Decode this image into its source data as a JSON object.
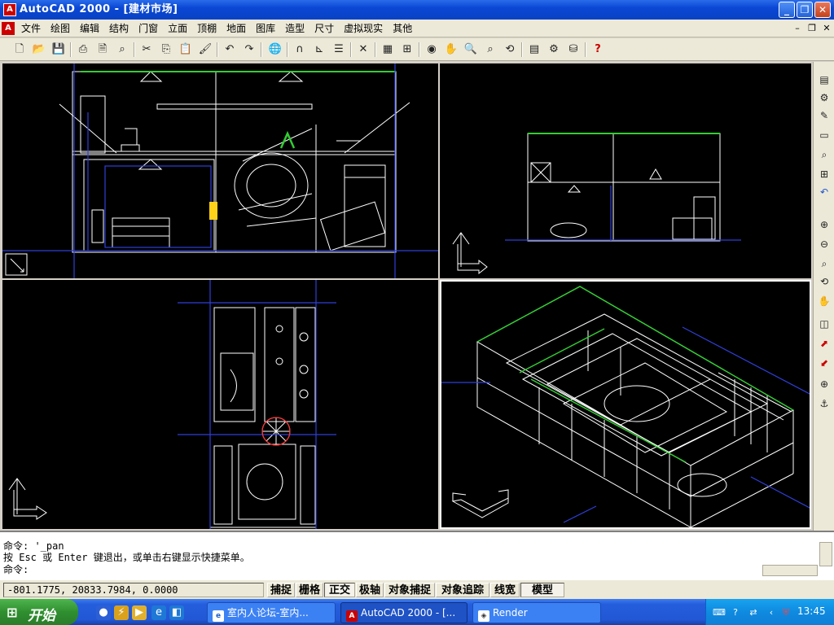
{
  "window": {
    "title": "AutoCAD 2000 - [建材市场]",
    "app_icon": "autocad-icon"
  },
  "menubar": {
    "items": [
      "文件",
      "绘图",
      "编辑",
      "结构",
      "门窗",
      "立面",
      "顶棚",
      "地面",
      "图库",
      "造型",
      "尺寸",
      "虚拟现实",
      "其他"
    ]
  },
  "toolbar": {
    "icons": [
      "new-icon",
      "open-icon",
      "save-icon",
      "print-icon",
      "print-preview-icon",
      "find-icon",
      "cut-icon",
      "copy-icon",
      "paste-icon",
      "match-properties-icon",
      "undo-icon",
      "redo-icon",
      "hyperlink-icon",
      "snap-icon",
      "ucs-icon",
      "list-icon",
      "measure-icon",
      "named-views-icon",
      "tiled-viewports-icon",
      "3d-orbit-icon",
      "pan-icon",
      "zoom-realtime-icon",
      "zoom-window-icon",
      "zoom-previous-icon",
      "properties-icon",
      "design-center-icon",
      "database-icon",
      "help-icon"
    ]
  },
  "colors": {
    "model_space": "#000000",
    "line_white": "#ffffff",
    "line_green": "#33cc33",
    "line_blue": "#2f3fd8",
    "line_yellow": "#ffd21a",
    "titlebar": "#0a47d4",
    "taskbar": "#245edc"
  },
  "command": {
    "lines": [
      "命令: '_pan",
      "按 Esc 或 Enter 键退出，或单击右键显示快捷菜单。",
      "命令:"
    ]
  },
  "status": {
    "coordinates": "-801.1775, 20833.7984, 0.0000",
    "buttons": [
      {
        "label": "捕捉",
        "on": false
      },
      {
        "label": "栅格",
        "on": false
      },
      {
        "label": "正交",
        "on": true
      },
      {
        "label": "极轴",
        "on": false
      },
      {
        "label": "对象捕捉",
        "on": false
      },
      {
        "label": "对象追踪",
        "on": false
      },
      {
        "label": "线宽",
        "on": false
      },
      {
        "label": "模型",
        "on": true
      }
    ]
  },
  "taskbar": {
    "start_label": "开始",
    "tasks": [
      {
        "label": "室内人论坛-室内...",
        "icon": "ie-icon",
        "active": false
      },
      {
        "label": "AutoCAD 2000 - [...",
        "icon": "autocad-icon",
        "active": true
      },
      {
        "label": "Render",
        "icon": "render-icon",
        "active": false
      }
    ],
    "clock": "13:45"
  }
}
